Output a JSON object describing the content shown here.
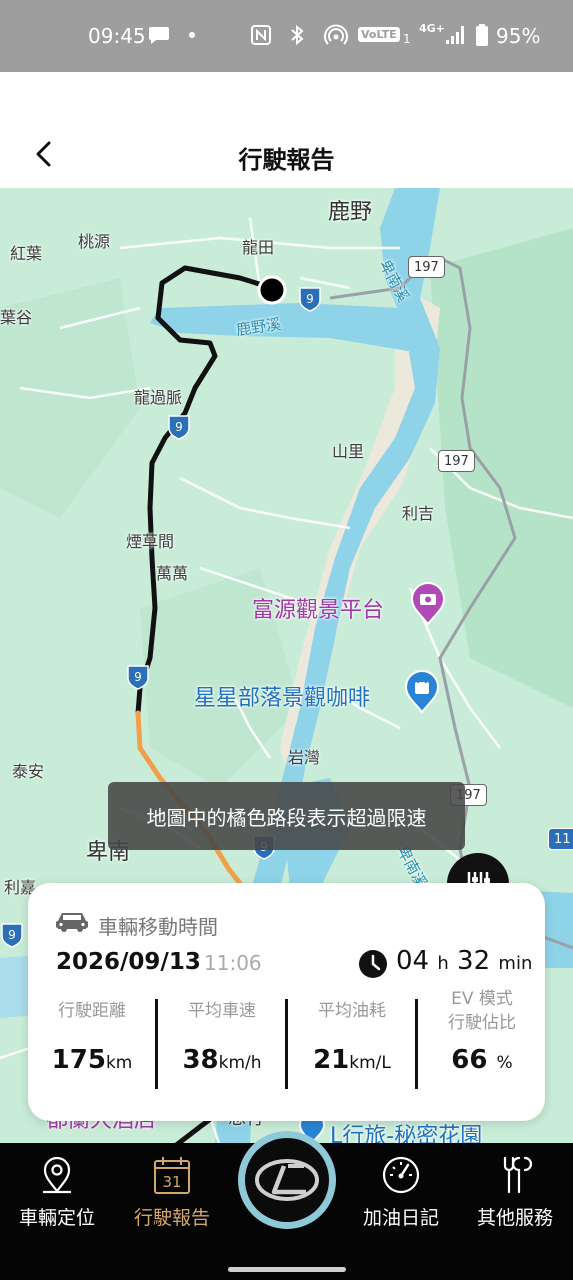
{
  "status_bar": {
    "time": "09:45",
    "icons": [
      "chat-icon",
      "dot-icon",
      "nfc-icon",
      "bluetooth-icon",
      "hotspot-icon",
      "volte-icon",
      "signal-icon",
      "battery-icon"
    ],
    "volte": "VoLTE",
    "sim": "1",
    "network": "4G+",
    "battery": "95%"
  },
  "header": {
    "title": "行駛報告",
    "back_icon": "chevron-left-icon"
  },
  "map": {
    "places": {
      "luye": "鹿野",
      "hongye": "紅葉",
      "taoyuan": "桃源",
      "longtian": "龍田",
      "yeguo": "葉谷",
      "longguomai": "龍過脈",
      "shanli": "山里",
      "liji": "利吉",
      "yancaojian": "煙草間",
      "wanwan": "萬萬",
      "yanwan": "岩灣",
      "taian": "泰安",
      "beinan": "卑南",
      "lijia": "利嘉"
    },
    "water": {
      "luye_river": "鹿野溪",
      "beinan_river": "卑南溪",
      "beinan_river_lower": "卑南溪"
    },
    "roads": {
      "r197_a": "197",
      "r197_b": "197",
      "r197_c": "197",
      "r9": "9",
      "r11": "11"
    },
    "pois": {
      "fuyuan": "富源觀景平台",
      "xingxing": "星星部落景觀咖啡",
      "hotel": "L行旅-秘密花園",
      "hotel_partial": "都蘭大酒店",
      "hotel_partial2": "想行"
    },
    "colors": {
      "route": "#111111",
      "speeding": "#f0a04b",
      "water": "#8fd3e8",
      "land": "#c8ecd7"
    }
  },
  "toast": {
    "text": "地圖中的橘色路段表示超過限速"
  },
  "filter_button": {
    "icon": "sliders-icon"
  },
  "trip": {
    "card_title": "車輛移動時間",
    "date": "2026/09/13",
    "start_time": "11:06",
    "duration_hours": "04",
    "duration_hours_unit": "h",
    "duration_minutes": "32",
    "duration_minutes_unit": "min",
    "stats": [
      {
        "label": "行駛距離",
        "value": "175",
        "unit": "km"
      },
      {
        "label": "平均車速",
        "value": "38",
        "unit": "km/h"
      },
      {
        "label": "平均油耗",
        "value": "21",
        "unit": "km/L"
      },
      {
        "label": "EV 模式\n行駛佔比",
        "label_line1": "EV 模式",
        "label_line2": "行駛佔比",
        "value": "66",
        "unit": "%"
      }
    ]
  },
  "bottom_nav": {
    "items": [
      {
        "label": "車輛定位",
        "icon": "location-pin-icon"
      },
      {
        "label": "行駛報告",
        "icon": "calendar-icon",
        "calendar_day": "31",
        "active": true
      },
      {
        "label": "加油日記",
        "icon": "speedometer-icon"
      },
      {
        "label": "其他服務",
        "icon": "tools-icon"
      }
    ],
    "center_icon": "lexus-logo-icon",
    "active_color": "#d3a66a"
  }
}
